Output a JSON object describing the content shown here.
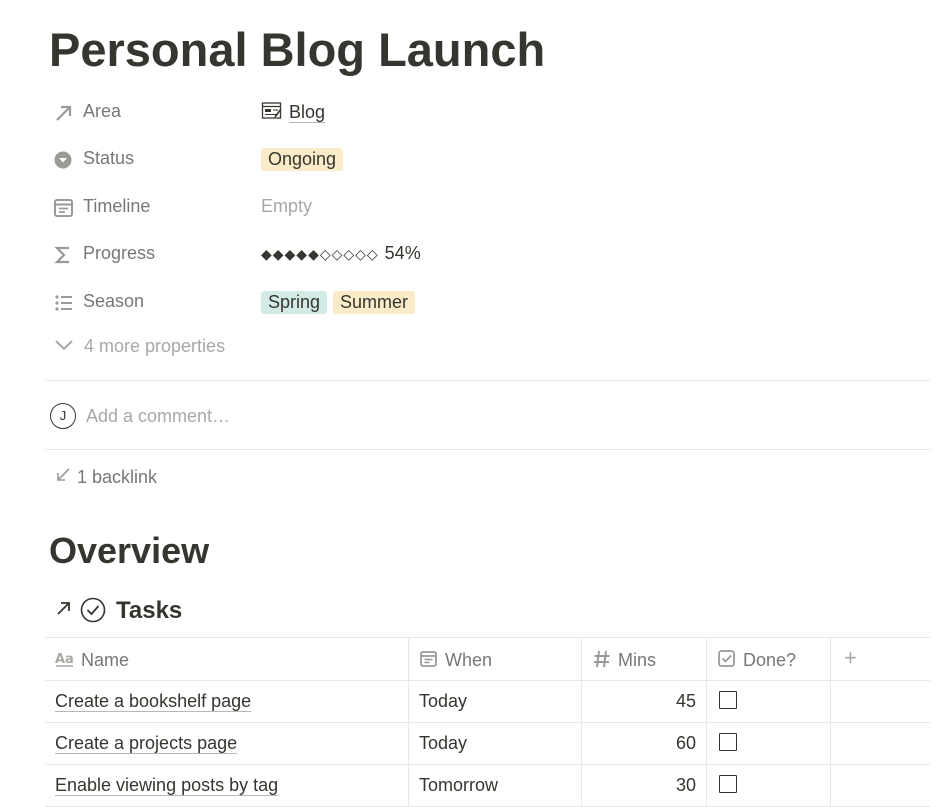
{
  "page": {
    "title": "Personal Blog Launch"
  },
  "properties": [
    {
      "icon": "arrow-up-right-icon",
      "label": "Area",
      "value": "Blog",
      "value_icon": "blog-page-icon"
    },
    {
      "icon": "status-circle-icon",
      "label": "Status",
      "value": "Ongoing"
    },
    {
      "icon": "calendar-icon",
      "label": "Timeline",
      "value": "Empty"
    },
    {
      "icon": "sigma-icon",
      "label": "Progress",
      "value_glyphs": "◆◆◆◆◆◇◇◇◇◇",
      "value": "54%"
    },
    {
      "icon": "list-icon",
      "label": "Season",
      "tags": [
        "Spring",
        "Summer"
      ]
    }
  ],
  "more_properties": "4 more properties",
  "comment": {
    "avatar": "J",
    "placeholder": "Add a comment…"
  },
  "backlink": "1 backlink",
  "overview": {
    "heading": "Overview"
  },
  "tasks": {
    "title": "Tasks",
    "columns": [
      {
        "icon": "text-aa-icon",
        "label": "Name"
      },
      {
        "icon": "calendar-icon",
        "label": "When"
      },
      {
        "icon": "hash-icon",
        "label": "Mins"
      },
      {
        "icon": "checkbox-icon",
        "label": "Done?"
      },
      {
        "icon": "plus-icon",
        "label": "+"
      }
    ],
    "rows": [
      {
        "name": "Create a bookshelf page",
        "when": "Today",
        "mins": "45",
        "done": false
      },
      {
        "name": "Create a projects page",
        "when": "Today",
        "mins": "60",
        "done": false
      },
      {
        "name": "Enable viewing posts by tag",
        "when": "Tomorrow",
        "mins": "30",
        "done": false
      }
    ]
  },
  "colors": {
    "tag_yellow": "#faecc8",
    "tag_teal": "#d2ebe6",
    "text": "#37352f",
    "muted": "#a9a8a4"
  }
}
